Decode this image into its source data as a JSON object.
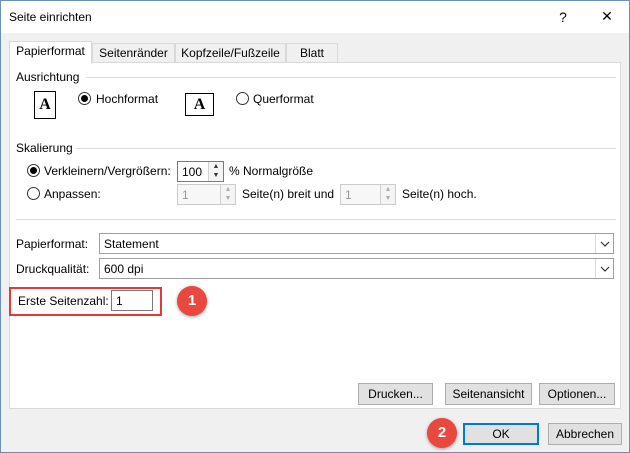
{
  "window": {
    "title": "Seite einrichten",
    "help": "?",
    "close": "✕"
  },
  "tabs": [
    {
      "label": "Papierformat",
      "active": true
    },
    {
      "label": "Seitenränder"
    },
    {
      "label": "Kopfzeile/Fußzeile"
    },
    {
      "label": "Blatt"
    }
  ],
  "orientation": {
    "heading": "Ausrichtung",
    "portrait_label": "Hochformat",
    "landscape_label": "Querformat",
    "selected": "portrait",
    "icon_letter": "A"
  },
  "scaling": {
    "heading": "Skalierung",
    "adjust_label": "Verkleinern/Vergrößern:",
    "adjust_value": "100",
    "adjust_suffix": "% Normalgröße",
    "fit_label": "Anpassen:",
    "fit_wide_value": "1",
    "fit_wide_suffix": "Seite(n) breit und",
    "fit_tall_value": "1",
    "fit_tall_suffix": "Seite(n) hoch.",
    "selected": "adjust"
  },
  "paper": {
    "size_label": "Papierformat:",
    "size_value": "Statement",
    "quality_label": "Druckqualität:",
    "quality_value": "600 dpi",
    "first_page_label": "Erste Seitenzahl:",
    "first_page_value": "1"
  },
  "buttons": {
    "print": "Drucken...",
    "preview": "Seitenansicht",
    "options": "Optionen...",
    "ok": "OK",
    "cancel": "Abbrechen"
  },
  "annotations": {
    "step1": "1",
    "step2": "2",
    "highlight_color": "#e03a3a",
    "badge_color": "#e8483e"
  }
}
